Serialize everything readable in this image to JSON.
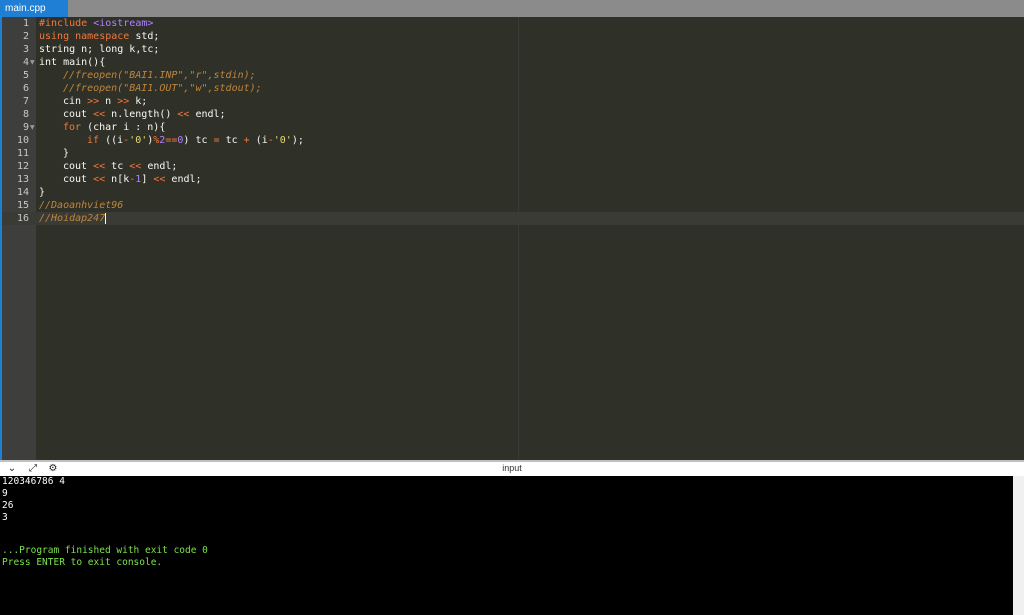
{
  "tab": {
    "label": "main.cpp"
  },
  "editor": {
    "line_numbers": [
      "1",
      "2",
      "3",
      "4",
      "5",
      "6",
      "7",
      "8",
      "9",
      "10",
      "11",
      "12",
      "13",
      "14",
      "15",
      "16"
    ],
    "lines": {
      "l1_a": "#include ",
      "l1_b": "<iostream>",
      "l2_a": "using namespace ",
      "l2_b": "std;",
      "l3": "string n; long k,tc;",
      "l4": "int main(){",
      "l5": "//freopen(\"BAI1.INP\",\"r\",stdin);",
      "l6": "//freopen(\"BAI1.OUT\",\"w\",stdout);",
      "l7_a": "cin ",
      "l7_b": ">>",
      "l7_c": " n ",
      "l7_d": ">>",
      "l7_e": " k;",
      "l8_a": "cout ",
      "l8_b": "<<",
      "l8_c": " n.length() ",
      "l8_d": "<<",
      "l8_e": " endl;",
      "l9_a": "for",
      "l9_b": " (char i : n){",
      "l10_a": "if",
      "l10_b": " ((i",
      "l10_c": "-",
      "l10_d": "'0'",
      "l10_e": ")",
      "l10_f": "%",
      "l10_g": "2",
      "l10_h": "==",
      "l10_i": "0",
      "l10_j": ") tc ",
      "l10_k": "=",
      "l10_l": " tc ",
      "l10_m": "+",
      "l10_n": " (i",
      "l10_o": "-",
      "l10_p": "'0'",
      "l10_q": ");",
      "l11": "}",
      "l12_a": "cout ",
      "l12_b": "<<",
      "l12_c": " tc ",
      "l12_d": "<<",
      "l12_e": " endl;",
      "l13_a": "cout ",
      "l13_b": "<<",
      "l13_c": " n[k",
      "l13_d": "-",
      "l13_e": "1",
      "l13_f": "] ",
      "l13_g": "<<",
      "l13_h": " endl;",
      "l14": "}",
      "l15": "//Daoanhviet96",
      "l16": "//Hoidap247"
    }
  },
  "console": {
    "title": "input",
    "icons": [
      "chevron-down-icon",
      "expand-icon",
      "settings-icon"
    ],
    "output": [
      "120346786 4",
      "9",
      "26",
      "3"
    ],
    "finished": "...Program finished with exit code 0",
    "press_enter": "Press ENTER to exit console."
  },
  "colors": {
    "editor_bg": "#2f3129",
    "keyword": "#f6763c",
    "string": "#e6db74",
    "comment": "#c0853a",
    "number": "#ae81ff",
    "console_bg": "#000000",
    "console_text": "#ffffff",
    "console_status": "#7ce34a",
    "tab_active": "#1f7fd4"
  }
}
